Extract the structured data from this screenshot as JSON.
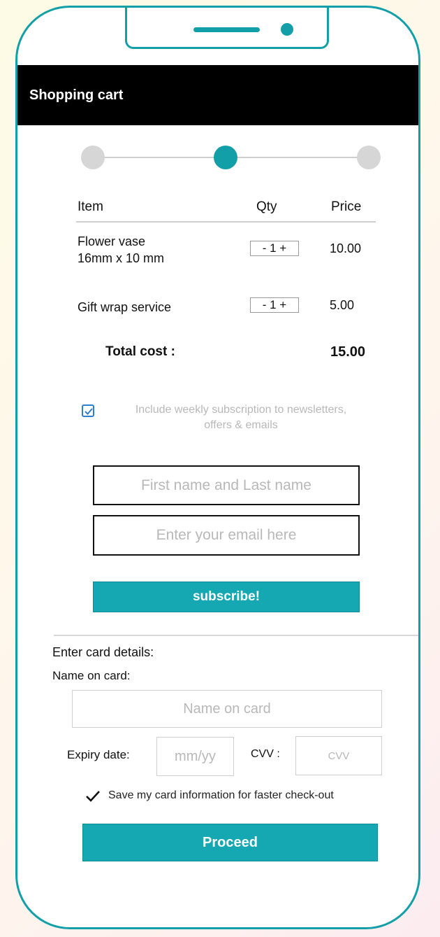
{
  "header": {
    "title": "Shopping cart"
  },
  "stepper": {
    "steps": 3,
    "active_step": 2
  },
  "cart": {
    "columns": {
      "item": "Item",
      "qty": "Qty",
      "price": "Price"
    },
    "rows": [
      {
        "item_line1": "Flower vase",
        "item_line2": "16mm x 10 mm",
        "qty": "- 1 +",
        "price": "10.00"
      },
      {
        "item_line1": "Gift wrap service",
        "item_line2": "",
        "qty": "- 1 +",
        "price": "5.00"
      }
    ],
    "total_label": "Total cost :",
    "total_value": "15.00"
  },
  "subscription": {
    "checked": true,
    "text_line1": "Include weekly subscription to newsletters,",
    "text_line2": "offers & emails",
    "name_placeholder": "First name and Last name",
    "email_placeholder": "Enter your email here",
    "button_label": "subscribe!"
  },
  "card": {
    "section_title": "Enter card details:",
    "name_label": "Name on card:",
    "name_placeholder": "Name on card",
    "expiry_label": "Expiry date:",
    "expiry_placeholder": "mm/yy",
    "cvv_label": "CVV :",
    "cvv_placeholder": "CVV",
    "save_checked": true,
    "save_text": "Save my card information for faster check-out",
    "proceed_label": "Proceed"
  },
  "colors": {
    "accent": "#16a8b2",
    "frame": "#139fa8",
    "header_bg": "#000000",
    "checkbox_blue": "#2e7fd0"
  }
}
